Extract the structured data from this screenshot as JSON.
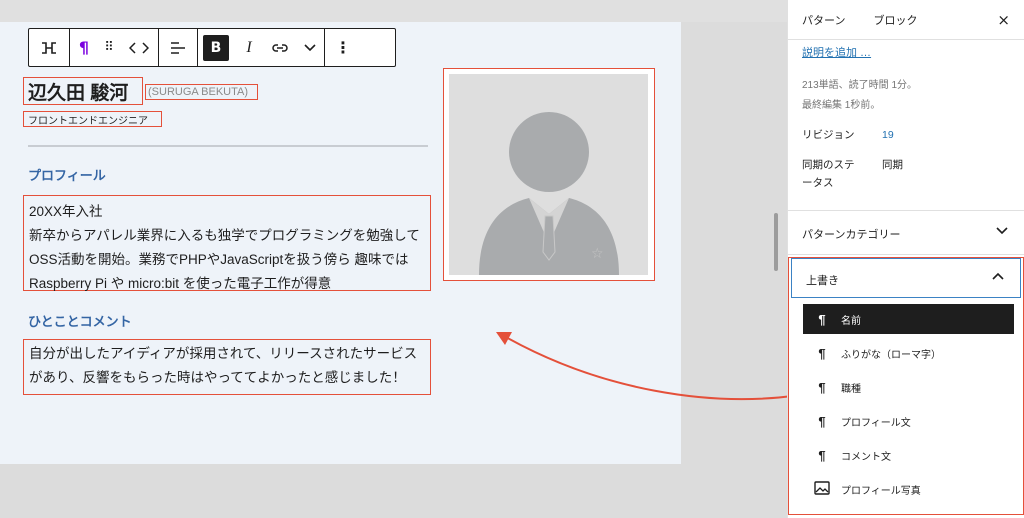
{
  "toolbar": {
    "buttons": [
      {
        "name": "block-transform",
        "glyph": "⊐⊏"
      },
      {
        "name": "paragraph-icon",
        "glyph": "¶"
      },
      {
        "name": "drag-handle",
        "glyph": "⠿"
      },
      {
        "name": "move-arrows",
        "glyph": "‹ ›"
      },
      {
        "name": "align",
        "glyph": "☰"
      },
      {
        "name": "bold",
        "glyph": "B"
      },
      {
        "name": "italic",
        "glyph": "I"
      },
      {
        "name": "link",
        "glyph": "⊖"
      },
      {
        "name": "more-formatting",
        "glyph": "⌄"
      },
      {
        "name": "options",
        "glyph": "⋮"
      }
    ]
  },
  "canvas": {
    "name": "辺久田 駿河",
    "romaji": "(SURUGA BEKUTA)",
    "job": "フロントエンドエンジニア",
    "profile_heading": "プロフィール",
    "profile_lines": [
      "20XX年入社",
      "新卒からアパレル業界に入るも独学でプログラミングを勉強して",
      "OSS活動を開始。業務でPHPやJavaScriptを扱う傍ら 趣味では",
      "Raspberry Pi や micro:bit を使った電子工作が得意"
    ],
    "comment_heading": "ひとことコメント",
    "comment_lines": [
      "自分が出したアイディアが採用されて、リリースされたサービス",
      "があり、反響をもらった時はやっててよかったと感じました！"
    ]
  },
  "sidebar": {
    "tabs": [
      "パターン",
      "ブロック"
    ],
    "close": "×",
    "add_description": "説明を追加 …",
    "meta_words": "213単語、読了時間 1分。",
    "meta_edited": "最終編集 1秒前。",
    "revision_label": "リビジョン",
    "revision_value": "19",
    "sync_label_1": "同期のステ",
    "sync_label_2": "ータス",
    "sync_value": "同期",
    "category_title": "パターンカテゴリー",
    "override_title": "上書き",
    "override_items": [
      {
        "icon": "paragraph-icon",
        "label": "名前",
        "selected": true
      },
      {
        "icon": "paragraph-icon",
        "label": "ふりがな（ローマ字）",
        "selected": false
      },
      {
        "icon": "paragraph-icon",
        "label": "職種",
        "selected": false
      },
      {
        "icon": "paragraph-icon",
        "label": "プロフィール文",
        "selected": false
      },
      {
        "icon": "paragraph-icon",
        "label": "コメント文",
        "selected": false
      },
      {
        "icon": "image-icon",
        "label": "プロフィール写真",
        "selected": false
      }
    ]
  },
  "colors": {
    "annotation": "#e4503a",
    "link": "#2271b1",
    "heading_blue": "#3465a4",
    "toolbar_active": "#1e1e1e"
  }
}
